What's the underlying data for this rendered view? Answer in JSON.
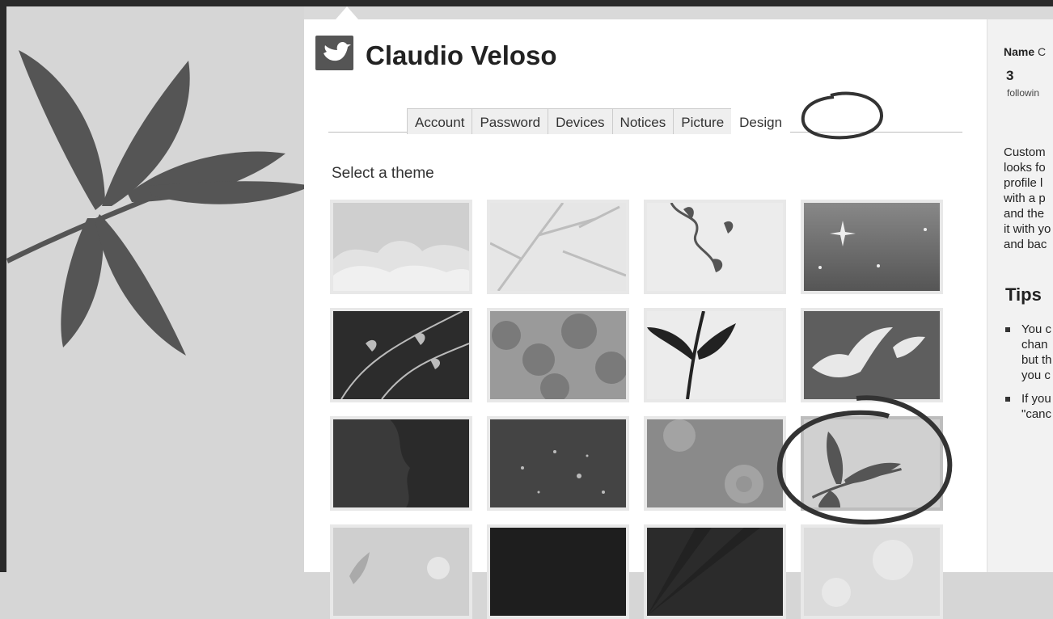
{
  "profile": {
    "name": "Claudio Veloso"
  },
  "tabs": [
    {
      "label": "Account"
    },
    {
      "label": "Password"
    },
    {
      "label": "Devices"
    },
    {
      "label": "Notices"
    },
    {
      "label": "Picture"
    },
    {
      "label": "Design",
      "active": true
    }
  ],
  "theme_section": {
    "label": "Select a theme",
    "themes": [
      {
        "name": "clouds"
      },
      {
        "name": "branches"
      },
      {
        "name": "vines"
      },
      {
        "name": "stars"
      },
      {
        "name": "dark-leaves"
      },
      {
        "name": "foliage"
      },
      {
        "name": "sprout"
      },
      {
        "name": "birds"
      },
      {
        "name": "dark-trees"
      },
      {
        "name": "fireflies"
      },
      {
        "name": "flowers"
      },
      {
        "name": "leaf",
        "selected": true
      },
      {
        "name": "plants"
      },
      {
        "name": "mesh"
      },
      {
        "name": "rays"
      },
      {
        "name": "bokeh"
      }
    ]
  },
  "sidebar": {
    "name_label": "Name",
    "name_value": "C",
    "following_count": "3",
    "following_label": "followin",
    "description_lines": [
      "Custom",
      "looks fo",
      "profile l",
      "with a p",
      "and the",
      "it with yo",
      "and bac"
    ],
    "tips_heading": "Tips",
    "tips": [
      [
        "You c",
        "chan",
        "but th",
        "you c"
      ],
      [
        "If you",
        "\"canc"
      ]
    ]
  }
}
